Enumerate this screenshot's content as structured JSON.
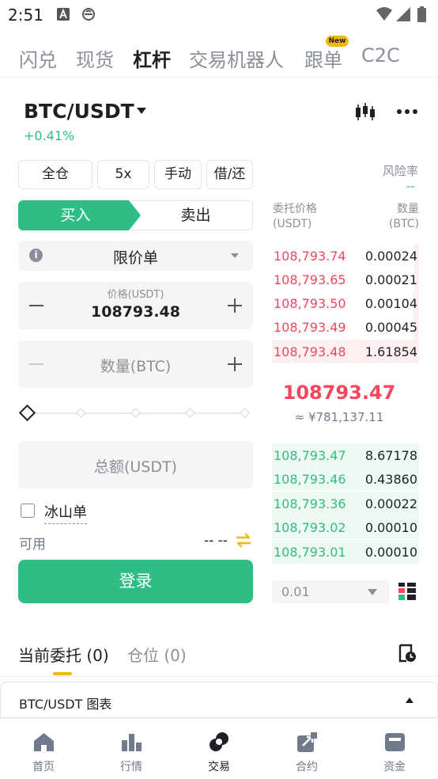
{
  "status_bar": {
    "time": "2:51"
  },
  "top_tabs": [
    {
      "label": "闪兑"
    },
    {
      "label": "现货"
    },
    {
      "label": "杠杆"
    },
    {
      "label": "交易机器人"
    },
    {
      "label": "跟单"
    },
    {
      "label": "C2C"
    }
  ],
  "new_badge": "New",
  "pair": {
    "symbol": "BTC/USDT",
    "change": "+0.41%"
  },
  "options": {
    "margin_mode": "全仓",
    "leverage": "5x",
    "mode": "手动",
    "borrow_repay": "借/还"
  },
  "risk": {
    "label": "风险率",
    "value": "--"
  },
  "side": {
    "buy": "买入",
    "sell": "卖出"
  },
  "order_type": "限价单",
  "price_field": {
    "label": "价格(USDT)",
    "value": "108793.48"
  },
  "quantity_field": {
    "placeholder": "数量(BTC)"
  },
  "total_field": {
    "placeholder": "总额(USDT)"
  },
  "iceberg": {
    "label": "冰山单"
  },
  "available": {
    "label": "可用",
    "value": "-- --"
  },
  "login_button": "登录",
  "orderbook": {
    "price_header": "委托价格",
    "price_unit": "(USDT)",
    "qty_header": "数量",
    "qty_unit": "(BTC)",
    "asks": [
      {
        "price": "108,793.74",
        "qty": "0.00024"
      },
      {
        "price": "108,793.65",
        "qty": "0.00021"
      },
      {
        "price": "108,793.50",
        "qty": "0.00104"
      },
      {
        "price": "108,793.49",
        "qty": "0.00045"
      },
      {
        "price": "108,793.48",
        "qty": "1.61854"
      }
    ],
    "last_price": "108793.47",
    "last_price_fiat": "≈ ¥781,137.11",
    "bids": [
      {
        "price": "108,793.47",
        "qty": "8.67178"
      },
      {
        "price": "108,793.46",
        "qty": "0.43860"
      },
      {
        "price": "108,793.36",
        "qty": "0.00022"
      },
      {
        "price": "108,793.02",
        "qty": "0.00010"
      },
      {
        "price": "108,793.01",
        "qty": "0.00010"
      }
    ],
    "depth": "0.01"
  },
  "orders_tabs": {
    "current": "当前委托 (0)",
    "positions": "仓位 (0)"
  },
  "chart_bar": "BTC/USDT 图表",
  "bottom_nav": [
    {
      "label": "首页",
      "icon": "home-icon"
    },
    {
      "label": "行情",
      "icon": "markets-icon"
    },
    {
      "label": "交易",
      "icon": "trade-icon"
    },
    {
      "label": "合约",
      "icon": "futures-icon"
    },
    {
      "label": "资金",
      "icon": "wallet-icon"
    }
  ],
  "colors": {
    "buy": "#2ebd85",
    "sell": "#f6465d",
    "accent": "#f0b90b"
  }
}
